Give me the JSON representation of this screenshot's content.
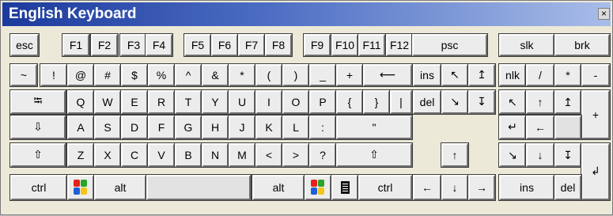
{
  "window": {
    "title": "English Keyboard",
    "close_label": "×"
  },
  "rows": [
    [
      {
        "id": "esc",
        "label": "esc"
      },
      {
        "id": "f1",
        "label": "F1"
      },
      {
        "id": "f2",
        "label": "F2"
      },
      {
        "id": "f3",
        "label": "F3"
      },
      {
        "id": "f4",
        "label": "F4"
      },
      {
        "id": "f5",
        "label": "F5"
      },
      {
        "id": "f6",
        "label": "F6"
      },
      {
        "id": "f7",
        "label": "F7"
      },
      {
        "id": "f8",
        "label": "F8"
      },
      {
        "id": "f9",
        "label": "F9"
      },
      {
        "id": "f10",
        "label": "F10"
      },
      {
        "id": "f11",
        "label": "F11"
      },
      {
        "id": "f12",
        "label": "F12"
      },
      {
        "id": "psc",
        "label": "psc"
      },
      {
        "id": "slk",
        "label": "slk"
      },
      {
        "id": "brk",
        "label": "brk"
      }
    ],
    [
      {
        "id": "tilde",
        "label": "~"
      },
      {
        "id": "exclaim",
        "label": "!"
      },
      {
        "id": "at",
        "label": "@"
      },
      {
        "id": "hash",
        "label": "#"
      },
      {
        "id": "dollar",
        "label": "$"
      },
      {
        "id": "percent",
        "label": "%"
      },
      {
        "id": "caret",
        "label": "^"
      },
      {
        "id": "ampersand",
        "label": "&"
      },
      {
        "id": "asterisk",
        "label": "*"
      },
      {
        "id": "lparen",
        "label": "("
      },
      {
        "id": "rparen",
        "label": ")"
      },
      {
        "id": "underscore",
        "label": "_"
      },
      {
        "id": "plus",
        "label": "+"
      },
      {
        "id": "backspace",
        "label": "⟵"
      },
      {
        "id": "ins",
        "label": "ins"
      },
      {
        "id": "home",
        "label": "↖"
      },
      {
        "id": "pgup",
        "label": "↥"
      },
      {
        "id": "nlk",
        "label": "nlk"
      },
      {
        "id": "num-divide",
        "label": "/"
      },
      {
        "id": "num-multiply",
        "label": "*"
      },
      {
        "id": "num-minus",
        "label": "-"
      }
    ],
    [
      {
        "id": "tab",
        "label": "⭾"
      },
      {
        "id": "q",
        "label": "Q"
      },
      {
        "id": "w",
        "label": "W"
      },
      {
        "id": "e",
        "label": "E"
      },
      {
        "id": "r",
        "label": "R"
      },
      {
        "id": "t",
        "label": "T"
      },
      {
        "id": "y",
        "label": "Y"
      },
      {
        "id": "u",
        "label": "U"
      },
      {
        "id": "i",
        "label": "I"
      },
      {
        "id": "o",
        "label": "O"
      },
      {
        "id": "p",
        "label": "P"
      },
      {
        "id": "lbrace",
        "label": "{"
      },
      {
        "id": "rbrace",
        "label": "}"
      },
      {
        "id": "pipe",
        "label": "|"
      },
      {
        "id": "del",
        "label": "del"
      },
      {
        "id": "end",
        "label": "↘"
      },
      {
        "id": "pgdn",
        "label": "↧"
      },
      {
        "id": "num7",
        "label": "↖"
      },
      {
        "id": "num8",
        "label": "↑"
      },
      {
        "id": "num9",
        "label": "↥"
      },
      {
        "id": "num-plus",
        "label": "+"
      }
    ],
    [
      {
        "id": "caps",
        "label": "⇩"
      },
      {
        "id": "a",
        "label": "A"
      },
      {
        "id": "s",
        "label": "S"
      },
      {
        "id": "d",
        "label": "D"
      },
      {
        "id": "f",
        "label": "F"
      },
      {
        "id": "g",
        "label": "G"
      },
      {
        "id": "h",
        "label": "H"
      },
      {
        "id": "j",
        "label": "J"
      },
      {
        "id": "k",
        "label": "K"
      },
      {
        "id": "l",
        "label": "L"
      },
      {
        "id": "colon",
        "label": ":"
      },
      {
        "id": "quote",
        "label": "\""
      },
      {
        "id": "enter",
        "label": "↵"
      },
      {
        "id": "num4",
        "label": "←"
      },
      {
        "id": "num5",
        "label": ""
      },
      {
        "id": "num6",
        "label": "→"
      }
    ],
    [
      {
        "id": "lshift",
        "label": "⇧"
      },
      {
        "id": "z",
        "label": "Z"
      },
      {
        "id": "x",
        "label": "X"
      },
      {
        "id": "c",
        "label": "C"
      },
      {
        "id": "v",
        "label": "V"
      },
      {
        "id": "b",
        "label": "B"
      },
      {
        "id": "n",
        "label": "N"
      },
      {
        "id": "m",
        "label": "M"
      },
      {
        "id": "lt",
        "label": "<"
      },
      {
        "id": "gt",
        "label": ">"
      },
      {
        "id": "question",
        "label": "?"
      },
      {
        "id": "rshift",
        "label": "⇧"
      },
      {
        "id": "up",
        "label": "↑"
      },
      {
        "id": "num1",
        "label": "↘"
      },
      {
        "id": "num2",
        "label": "↓"
      },
      {
        "id": "num3",
        "label": "↧"
      },
      {
        "id": "num-enter",
        "label": "↲"
      }
    ],
    [
      {
        "id": "lctrl",
        "label": "ctrl"
      },
      {
        "id": "lwin",
        "label": ""
      },
      {
        "id": "lalt",
        "label": "alt"
      },
      {
        "id": "space",
        "label": ""
      },
      {
        "id": "ralt",
        "label": "alt"
      },
      {
        "id": "rwin",
        "label": ""
      },
      {
        "id": "menu",
        "label": ""
      },
      {
        "id": "rctrl",
        "label": "ctrl"
      },
      {
        "id": "left",
        "label": "←"
      },
      {
        "id": "down",
        "label": "↓"
      },
      {
        "id": "right",
        "label": "→"
      },
      {
        "id": "num0",
        "label": "ins"
      },
      {
        "id": "num-del",
        "label": "del"
      }
    ]
  ]
}
